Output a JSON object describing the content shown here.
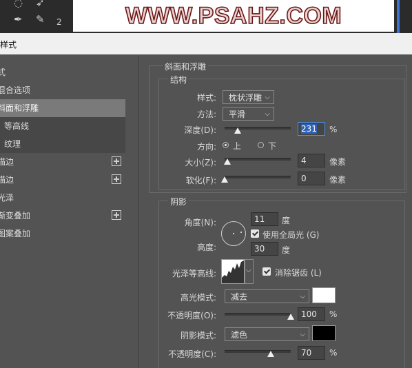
{
  "banner": {
    "text": "WWW.PSAHZ.COM"
  },
  "toolbar": {
    "number": "2"
  },
  "dialog": {
    "title": "样式"
  },
  "left_list": [
    {
      "label": "式",
      "selected": false,
      "sub": false,
      "plus": false
    },
    {
      "label": "混合选项",
      "selected": false,
      "sub": false,
      "plus": false
    },
    {
      "label": "斜面和浮雕",
      "selected": true,
      "sub": false,
      "plus": false
    },
    {
      "label": "等高线",
      "selected": false,
      "sub": true,
      "plus": false
    },
    {
      "label": "纹理",
      "selected": false,
      "sub": true,
      "plus": false
    },
    {
      "label": "描边",
      "selected": false,
      "sub": false,
      "plus": true
    },
    {
      "label": "描边",
      "selected": false,
      "sub": false,
      "plus": true
    },
    {
      "label": "光泽",
      "selected": false,
      "sub": false,
      "plus": false
    },
    {
      "label": "渐变叠加",
      "selected": false,
      "sub": false,
      "plus": true
    },
    {
      "label": "图案叠加",
      "selected": false,
      "sub": false,
      "plus": false
    }
  ],
  "bevel": {
    "group_title": "斜面和浮雕",
    "structure_title": "结构",
    "style_label": "样式:",
    "style_value": "枕状浮雕",
    "technique_label": "方法:",
    "technique_value": "平滑",
    "depth_label": "深度(D):",
    "depth_value": "231",
    "depth_slider": 0.2,
    "percent": "%",
    "direction_label": "方向:",
    "direction_up": "上",
    "direction_down": "下",
    "direction_selected": "up",
    "size_label": "大小(Z):",
    "size_value": "4",
    "size_slider": 0.04,
    "soften_label": "软化(F):",
    "soften_value": "0",
    "soften_slider": 0.0,
    "pixels": "像素"
  },
  "shading": {
    "group_title": "阴影",
    "angle_label": "角度(N):",
    "angle_value": "11",
    "degree": "度",
    "global_light_label": "使用全局光 (G)",
    "global_light_checked": true,
    "altitude_label": "高度:",
    "altitude_value": "30",
    "gloss_contour_label": "光泽等高线:",
    "anti_alias_label": "消除锯齿 (L)",
    "anti_alias_checked": true,
    "highlight_mode_label": "高光模式:",
    "highlight_mode_value": "减去",
    "highlight_color": "#ffffff",
    "highlight_opacity_label": "不透明度(O):",
    "highlight_opacity_value": "100",
    "highlight_opacity_slider": 1.0,
    "shadow_mode_label": "阴影模式:",
    "shadow_mode_value": "滤色",
    "shadow_color": "#000000",
    "shadow_opacity_label": "不透明度(C):",
    "shadow_opacity_value": "70",
    "shadow_opacity_slider": 0.7,
    "percent": "%"
  },
  "colors": {
    "background": "#535353",
    "selected_item": "#7a7a7a",
    "accent": "#3a73d6"
  }
}
